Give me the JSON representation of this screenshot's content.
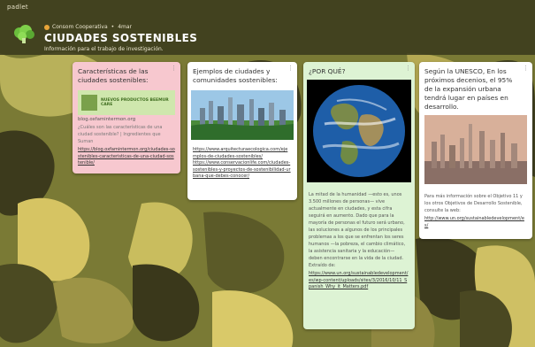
{
  "app": {
    "brand": "padlet"
  },
  "header": {
    "author": "Consom Cooperativa",
    "separator": "•",
    "age": "4mar",
    "title": "CIUDADES SOSTENIBLES",
    "subtitle": "Información para el trabajo de investigación."
  },
  "posts": [
    {
      "title": "Características de las ciudades sostenibles:",
      "preview_url": "blog.oxfamintermon.org",
      "preview_banner": "NUEVOS PRODUCTOS BEEMUR CARE",
      "body": "¿Cuáles son las características de una ciudad sostenible? | Ingredientes que Suman",
      "link": "https://blog.oxfamintermon.org/ciudades-sostenibles-caracteristicas-de-una-ciudad-sostenible/"
    },
    {
      "title": "Ejemplos de ciudades y comunidades sostenibles:",
      "link1": "https://www.arquitecturaecologica.com/ejemplos-de-ciudades-sostenibles/",
      "link2": "https://www.conservacionlife.com/ciudades-sostenibles-y-proyectos-de-sostenibilidad-urbana-que-debes-conocer/"
    },
    {
      "title": "¿POR QUÉ?",
      "body": "La mitad de la humanidad —esto es, unos 3.500 millones de personas— vive actualmente en ciudades, y esta cifra seguirá en aumento. Dado que para la mayoría de personas el futuro será urbano, las soluciones a algunos de los principales problemas a los que se enfrentan los seres humanos —la pobreza, el cambio climático, la asistencia sanitaria y la educación— deben encontrarse en la vida de la ciudad. Extraído de:",
      "link": "https://www.un.org/sustainabledevelopment/es/wp-content/uploads/sites/3/2016/10/11_Spanish_Why_it_Matters.pdf"
    },
    {
      "title": "Según la UNESCO, En los próximos decenios, el 95% de la expansión urbana tendrá lugar en países en desarrollo.",
      "body": "Para más información sobre el Objetivo 11 y los otros Objetivos de Desarrollo Sostenible, consulte la web:",
      "link": "http://www.un.org/sustainabledevelopment/es/"
    }
  ],
  "icons": {
    "menu": "more-vertical-icon",
    "avatar": "broccoli-avatar-icon"
  },
  "colors": {
    "card_pink": "#f7c8cf",
    "card_green": "#ddf3d4",
    "card_white": "#ffffff",
    "wallpaper_green": "#6b6a2a"
  }
}
